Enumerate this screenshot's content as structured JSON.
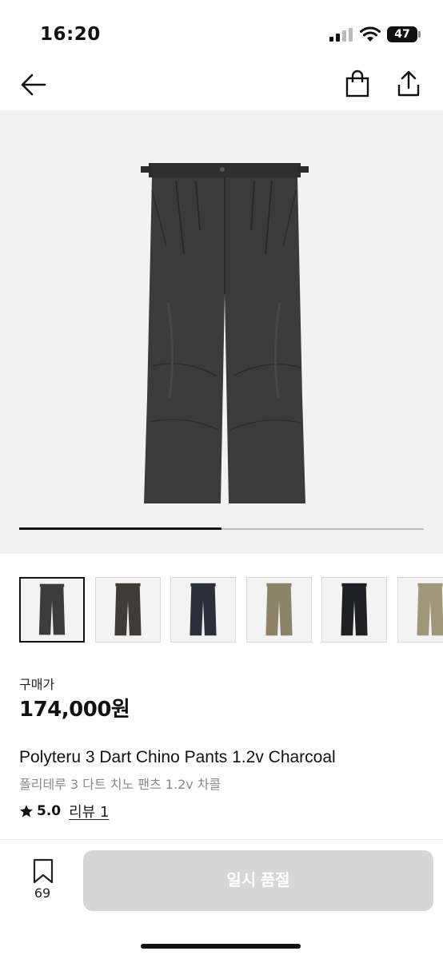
{
  "status_bar": {
    "time": "16:20",
    "battery": "47"
  },
  "product": {
    "image_index": 1,
    "image_count": 2,
    "price_label": "구매가",
    "price": "174,000원",
    "title": "Polyteru 3 Dart Chino Pants 1.2v Charcoal",
    "subtitle": "폴리테루 3 다트 치노 팬츠 1.2v 차콜",
    "rating": "5.0",
    "review_link": "리뷰 1"
  },
  "thumbnails": [
    {
      "color_name": "charcoal",
      "color": "#3c3c3c",
      "selected": true
    },
    {
      "color_name": "dark olive",
      "color": "#3e3c35",
      "selected": false
    },
    {
      "color_name": "navy",
      "color": "#2a2f3a",
      "selected": false
    },
    {
      "color_name": "khaki",
      "color": "#8c846a",
      "selected": false
    },
    {
      "color_name": "black",
      "color": "#1e2026",
      "selected": false
    },
    {
      "color_name": "beige",
      "color": "#9e9779",
      "selected": false
    }
  ],
  "bottom_bar": {
    "wish_count": "69",
    "buy_button": "일시 품절"
  },
  "icons": {
    "back": "arrow-left-icon",
    "bag": "shopping-bag-icon",
    "share": "share-icon",
    "star": "star-icon",
    "bookmark": "bookmark-icon"
  },
  "colors": {
    "button_disabled": "#d6d6d6",
    "hero_background": "#f2f2f2",
    "subtitle": "#8a8a8a"
  }
}
